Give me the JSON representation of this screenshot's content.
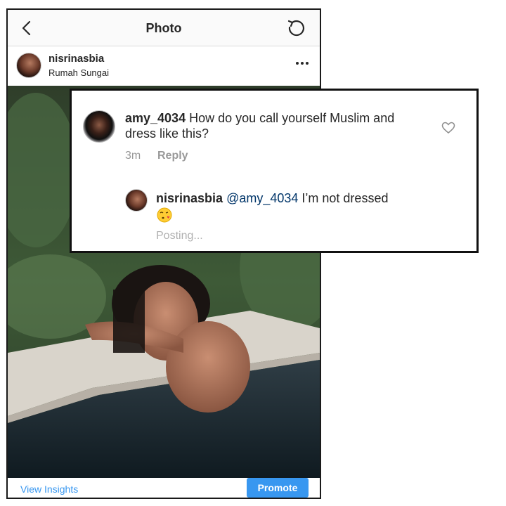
{
  "topbar": {
    "title": "Photo",
    "back_icon": "chevron-left-icon",
    "refresh_icon": "refresh-icon"
  },
  "post": {
    "username": "nisrinasbia",
    "location": "Rumah Sungai",
    "more_icon": "more-horizontal-icon"
  },
  "bottom": {
    "insights_label": "View Insights",
    "promote_label": "Promote"
  },
  "comment": {
    "username": "amy_4034",
    "text": " How do you call yourself Muslim and dress like this?",
    "time": "3m",
    "reply_label": "Reply",
    "like_icon": "heart-icon"
  },
  "reply": {
    "username": "nisrinasbia",
    "mention": "@amy_4034",
    "text": " I’m not dressed",
    "emoji_icon": "face-blowing-kiss-icon",
    "status": "Posting..."
  },
  "colors": {
    "link_blue": "#3897f0",
    "muted_text": "#999999",
    "border": "#111111"
  }
}
